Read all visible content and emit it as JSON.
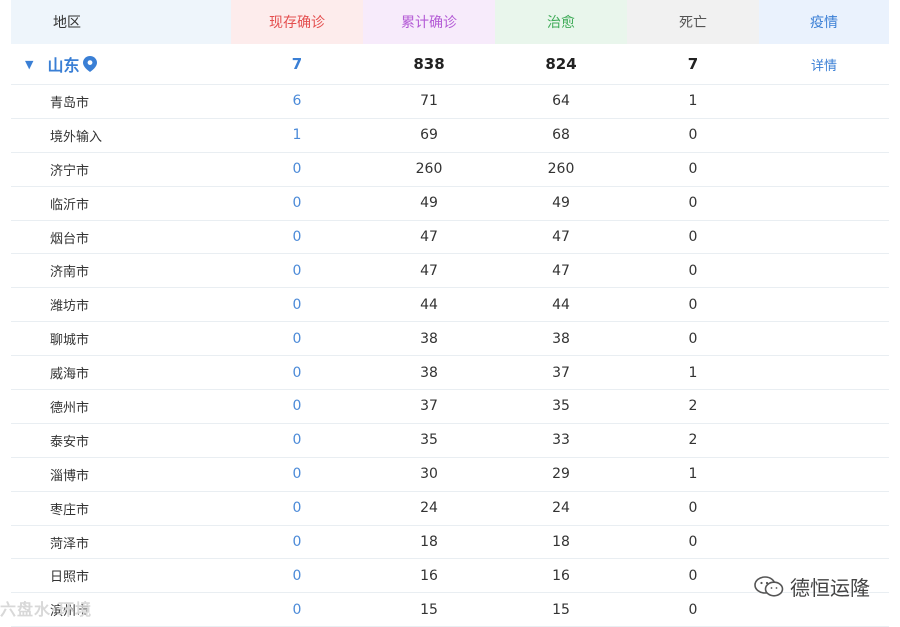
{
  "header": {
    "region": "地区",
    "current": "现存确诊",
    "total": "累计确诊",
    "cured": "治愈",
    "dead": "死亡",
    "more": "疫情"
  },
  "province": {
    "name": "山东",
    "current": "7",
    "total": "838",
    "cured": "824",
    "dead": "7",
    "detail": "详情"
  },
  "cities": [
    {
      "name": "青岛市",
      "current": "6",
      "total": "71",
      "cured": "64",
      "dead": "1"
    },
    {
      "name": "境外输入",
      "current": "1",
      "total": "69",
      "cured": "68",
      "dead": "0"
    },
    {
      "name": "济宁市",
      "current": "0",
      "total": "260",
      "cured": "260",
      "dead": "0"
    },
    {
      "name": "临沂市",
      "current": "0",
      "total": "49",
      "cured": "49",
      "dead": "0"
    },
    {
      "name": "烟台市",
      "current": "0",
      "total": "47",
      "cured": "47",
      "dead": "0"
    },
    {
      "name": "济南市",
      "current": "0",
      "total": "47",
      "cured": "47",
      "dead": "0"
    },
    {
      "name": "潍坊市",
      "current": "0",
      "total": "44",
      "cured": "44",
      "dead": "0"
    },
    {
      "name": "聊城市",
      "current": "0",
      "total": "38",
      "cured": "38",
      "dead": "0"
    },
    {
      "name": "威海市",
      "current": "0",
      "total": "38",
      "cured": "37",
      "dead": "1"
    },
    {
      "name": "德州市",
      "current": "0",
      "total": "37",
      "cured": "35",
      "dead": "2"
    },
    {
      "name": "泰安市",
      "current": "0",
      "total": "35",
      "cured": "33",
      "dead": "2"
    },
    {
      "name": "淄博市",
      "current": "0",
      "total": "30",
      "cured": "29",
      "dead": "1"
    },
    {
      "name": "枣庄市",
      "current": "0",
      "total": "24",
      "cured": "24",
      "dead": "0"
    },
    {
      "name": "菏泽市",
      "current": "0",
      "total": "18",
      "cured": "18",
      "dead": "0"
    },
    {
      "name": "日照市",
      "current": "0",
      "total": "16",
      "cured": "16",
      "dead": "0"
    },
    {
      "name": "滨州市",
      "current": "0",
      "total": "15",
      "cured": "15",
      "dead": "0"
    }
  ],
  "watermark": {
    "text": "德恒运隆",
    "icon": "wechat-icon"
  },
  "corner_watermark": {
    "text": "六盘水·环境"
  },
  "colors": {
    "accent_blue": "#3a7fd5",
    "current_red": "#e44f4f",
    "total_purple": "#b45bd6",
    "cured_green": "#3fab58"
  }
}
